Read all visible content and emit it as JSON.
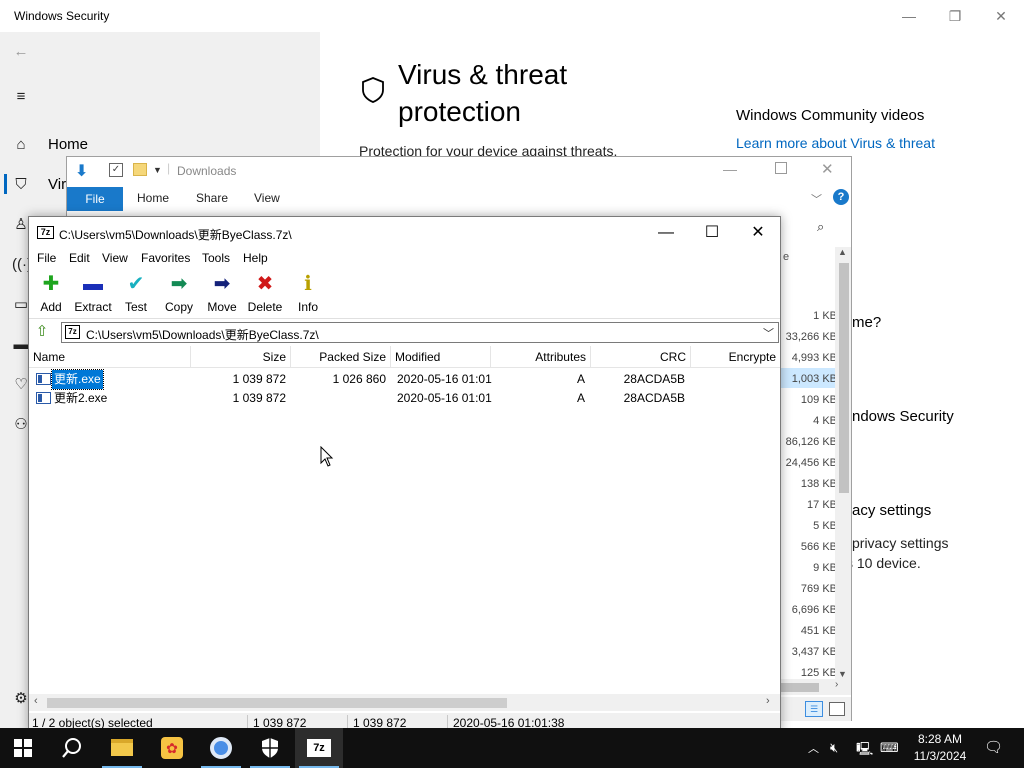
{
  "windows_security": {
    "title": "Windows Security",
    "nav": {
      "home": "Home",
      "virus_partial": "Viru"
    },
    "heading": "Virus & threat protection",
    "subtitle": "Protection for your device against threats.",
    "community_title": "Windows Community videos",
    "community_link": "Learn more about Virus & threat",
    "frag_question": "me?",
    "frag_security": "ndows Security",
    "frag_privacy": "acy settings",
    "frag_privacy2": "privacy settings",
    "frag_device": "s 10 device."
  },
  "explorer": {
    "title": "Downloads",
    "tabs": {
      "file": "File",
      "home": "Home",
      "share": "Share",
      "view": "View"
    },
    "column_fragment": "e",
    "sizes": [
      "1 KB",
      "33,266 KB",
      "4,993 KB",
      "1,003 KB",
      "109 KB",
      "4 KB",
      "86,126 KB",
      "24,456 KB",
      "138 KB",
      "17 KB",
      "5 KB",
      "566 KB",
      "9 KB",
      "769 KB",
      "6,696 KB",
      "451 KB",
      "3,437 KB",
      "125 KB"
    ]
  },
  "sevenzip": {
    "title": "C:\\Users\\vm5\\Downloads\\更新ByeClass.7z\\",
    "title_icon": "7z",
    "menu": {
      "file": "File",
      "edit": "Edit",
      "view": "View",
      "favorites": "Favorites",
      "tools": "Tools",
      "help": "Help"
    },
    "toolbar": {
      "add": "Add",
      "extract": "Extract",
      "test": "Test",
      "copy": "Copy",
      "move": "Move",
      "delete": "Delete",
      "info": "Info"
    },
    "address": "C:\\Users\\vm5\\Downloads\\更新ByeClass.7z\\",
    "columns": {
      "name": "Name",
      "size": "Size",
      "packed": "Packed Size",
      "modified": "Modified",
      "attributes": "Attributes",
      "crc": "CRC",
      "encrypted": "Encrypte"
    },
    "rows": [
      {
        "name": "更新.exe",
        "size": "1 039 872",
        "packed": "1 026 860",
        "modified": "2020-05-16 01:01",
        "attributes": "A",
        "crc": "28ACDA5B",
        "selected": true
      },
      {
        "name": "更新2.exe",
        "size": "1 039 872",
        "packed": "",
        "modified": "2020-05-16 01:01",
        "attributes": "A",
        "crc": "28ACDA5B",
        "selected": false
      }
    ],
    "status": {
      "selection": "1 / 2 object(s) selected",
      "size": "1 039 872",
      "packed": "1 039 872",
      "modified": "2020-05-16 01:01:38"
    }
  },
  "taskbar": {
    "apps": [
      "start-icon",
      "search-icon",
      "file-explorer-icon",
      "paint-icon",
      "chrome-icon",
      "windows-security-icon",
      "7zip-icon"
    ],
    "sevenzip_label": "7z",
    "time": "8:28 AM",
    "date": "11/3/2024"
  },
  "colors": {
    "accent": "#0078d7",
    "ribbon_file": "#1979ca",
    "link": "#0067c0",
    "taskbar": "#101010"
  }
}
